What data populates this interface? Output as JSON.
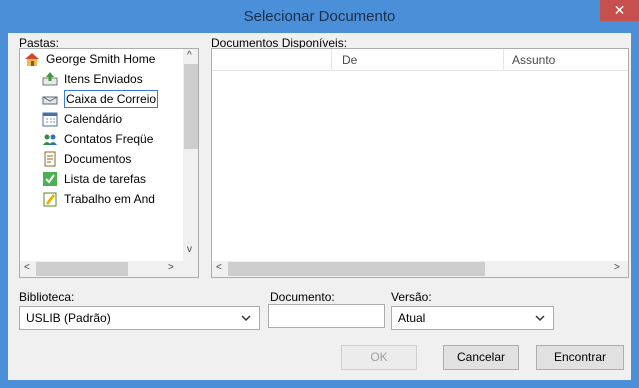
{
  "window": {
    "title": "Selecionar Documento",
    "close_glyph": "✕"
  },
  "labels": {
    "pastas": "Pastas:",
    "documentos": "Documentos Disponíveis:",
    "biblioteca": "Biblioteca:",
    "documento": "Documento:",
    "versao": "Versão:"
  },
  "tree": {
    "items": [
      {
        "label": "George Smith Home",
        "icon": "home-icon"
      },
      {
        "label": "Itens Enviados",
        "icon": "sent-items-icon"
      },
      {
        "label": "Caixa de Correio",
        "icon": "mailbox-icon"
      },
      {
        "label": "Calendário",
        "icon": "calendar-icon"
      },
      {
        "label": "Contatos Freqüe",
        "icon": "contacts-icon"
      },
      {
        "label": "Documentos",
        "icon": "documents-icon"
      },
      {
        "label": "Lista de tarefas",
        "icon": "tasks-icon"
      },
      {
        "label": "Trabalho em And",
        "icon": "work-in-progress-icon"
      }
    ]
  },
  "list": {
    "columns": [
      "De",
      "Assunto"
    ]
  },
  "biblioteca": {
    "value": "USLIB  (Padrão)"
  },
  "documento": {
    "value": ""
  },
  "versao": {
    "value": "Atual"
  },
  "buttons": {
    "ok": "OK",
    "cancel": "Cancelar",
    "find": "Encontrar"
  },
  "scroll_glyphs": {
    "up": "^",
    "down": "v",
    "left": "<",
    "right": ">"
  },
  "colors": {
    "titlebar": "#4a8fd8",
    "close": "#c7504f"
  }
}
